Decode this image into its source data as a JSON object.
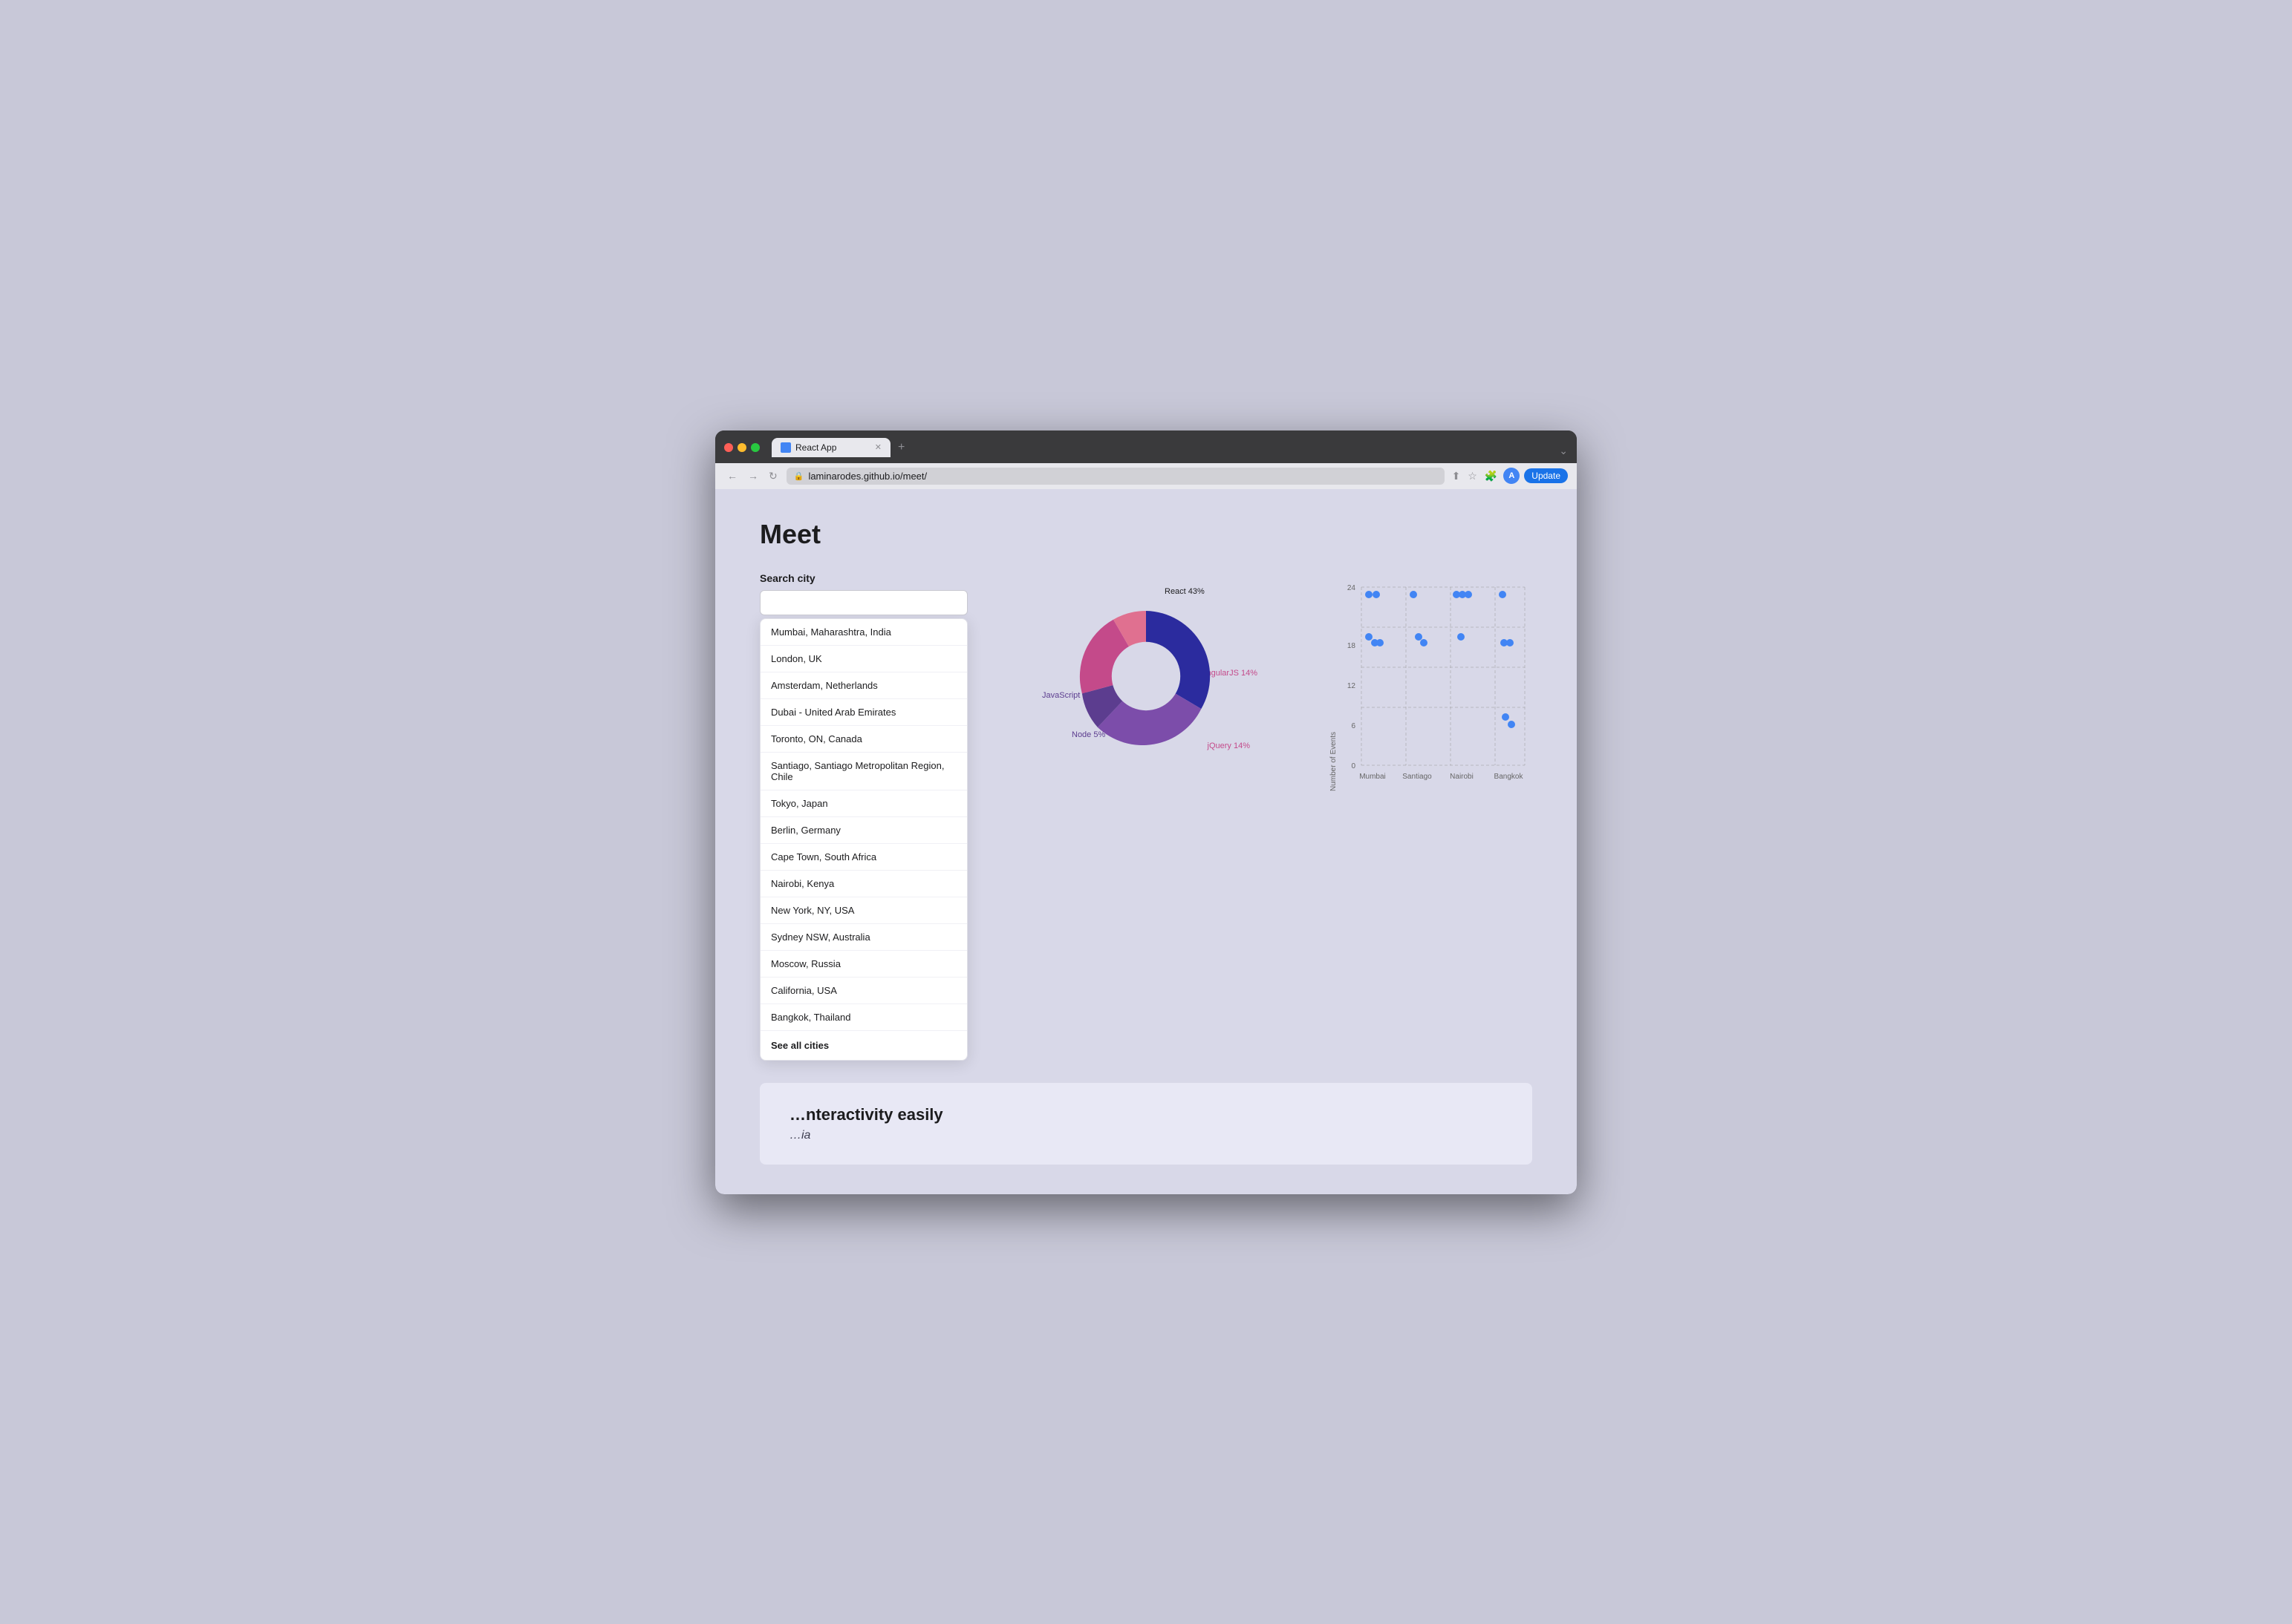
{
  "browser": {
    "tab_title": "React App",
    "url": "laminarodes.github.io/meet/",
    "new_tab_label": "+",
    "back_btn": "←",
    "forward_btn": "→",
    "refresh_btn": "↻",
    "update_label": "Update"
  },
  "page": {
    "title": "Meet",
    "search_label": "Search city",
    "search_placeholder": "",
    "cities": [
      "Mumbai, Maharashtra, India",
      "London, UK",
      "Amsterdam, Netherlands",
      "Dubai - United Arab Emirates",
      "Toronto, ON, Canada",
      "Santiago, Santiago Metropolitan Region, Chile",
      "Tokyo, Japan",
      "Berlin, Germany",
      "Cape Town, South Africa",
      "Nairobi, Kenya",
      "New York, NY, USA",
      "Sydney NSW, Australia",
      "Moscow, Russia",
      "California, USA",
      "Bangkok, Thailand",
      "See all cities"
    ],
    "donut": {
      "segments": [
        {
          "label": "React 43%",
          "value": 43,
          "color": "#2b2b9e",
          "angle_start": 0,
          "angle_end": 155
        },
        {
          "label": "JavaScript 24%",
          "value": 24,
          "color": "#7c4daa",
          "angle_start": 155,
          "angle_end": 241
        },
        {
          "label": "Node 5%",
          "value": 5,
          "color": "#5c3d8f",
          "angle_start": 241,
          "angle_end": 259
        },
        {
          "label": "jQuery 14%",
          "value": 14,
          "color": "#c44a8a",
          "angle_start": 259,
          "angle_end": 309
        },
        {
          "label": "AngularJS 14%",
          "value": 14,
          "color": "#e07090",
          "angle_start": 309,
          "angle_end": 360
        }
      ]
    },
    "scatter": {
      "y_label": "Number of Events",
      "y_max": 24,
      "y_ticks": [
        0,
        6,
        12,
        18,
        24
      ],
      "x_labels": [
        "Mumbai",
        "Santiago",
        "Nairobi",
        "Bangkok"
      ],
      "points": [
        {
          "x": "Mumbai",
          "y": 23
        },
        {
          "x": "Mumbai",
          "y": 22
        },
        {
          "x": "Mumbai",
          "y": 16
        },
        {
          "x": "Mumbai",
          "y": 15
        },
        {
          "x": "Mumbai",
          "y": 15
        },
        {
          "x": "Santiago",
          "y": 23
        },
        {
          "x": "Santiago",
          "y": 16
        },
        {
          "x": "Santiago",
          "y": 15
        },
        {
          "x": "Nairobi",
          "y": 23
        },
        {
          "x": "Nairobi",
          "y": 23
        },
        {
          "x": "Nairobi",
          "y": 23
        },
        {
          "x": "Nairobi",
          "y": 16
        },
        {
          "x": "Bangkok",
          "y": 23
        },
        {
          "x": "Bangkok",
          "y": 15
        },
        {
          "x": "Bangkok",
          "y": 15
        },
        {
          "x": "Bangkok",
          "y": 7
        },
        {
          "x": "Bangkok",
          "y": 6
        }
      ]
    },
    "bottom": {
      "title": "nteractivity easily",
      "subtitle": "ia"
    }
  }
}
